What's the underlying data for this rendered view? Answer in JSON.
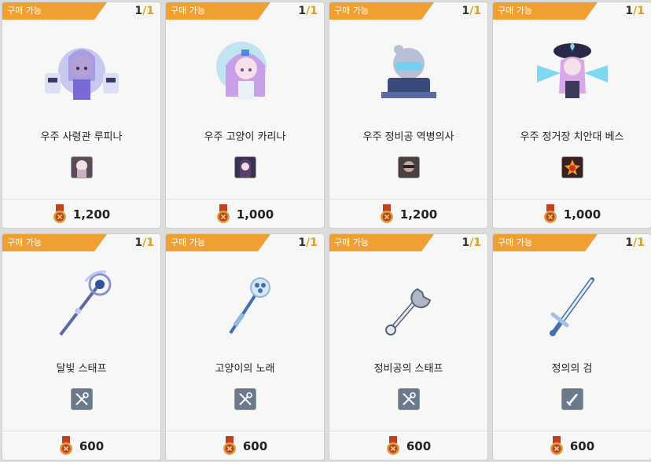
{
  "status_label": "구매 가능",
  "items": [
    {
      "name": "우주 사령관 루피나",
      "stock_current": "1",
      "stock_sep": "/",
      "stock_max": "1",
      "price": "1,200",
      "icon": "character-icon",
      "thumb_icon": "portrait-icon",
      "art_colors": [
        "#c8c8f0",
        "#7a6ad8",
        "#f4d4c0"
      ]
    },
    {
      "name": "우주 고양이 카리나",
      "stock_current": "1",
      "stock_sep": "/",
      "stock_max": "1",
      "price": "1,000",
      "icon": "character-icon",
      "thumb_icon": "portrait-icon",
      "art_colors": [
        "#a8dcf0",
        "#c8a0e8",
        "#f8e0e8"
      ]
    },
    {
      "name": "우주 정비공 역병의사",
      "stock_current": "1",
      "stock_sep": "/",
      "stock_max": "1",
      "price": "1,200",
      "icon": "character-icon",
      "thumb_icon": "portrait-icon",
      "art_colors": [
        "#b8c0d8",
        "#3a4a7a",
        "#70d0f0"
      ]
    },
    {
      "name": "우주 정거장 치안대 베스",
      "stock_current": "1",
      "stock_sep": "/",
      "stock_max": "1",
      "price": "1,000",
      "icon": "character-icon",
      "thumb_icon": "portrait-icon",
      "art_colors": [
        "#80d8f0",
        "#2a2a48",
        "#d8a8e8"
      ]
    },
    {
      "name": "달빛 스태프",
      "stock_current": "1",
      "stock_sep": "/",
      "stock_max": "1",
      "price": "600",
      "icon": "staff-icon",
      "thumb_icon": "weapon-icon",
      "art_colors": [
        "#8890d8",
        "#3050a0",
        "#c0c8f0"
      ]
    },
    {
      "name": "고양이의 노래",
      "stock_current": "1",
      "stock_sep": "/",
      "stock_max": "1",
      "price": "600",
      "icon": "staff-icon",
      "thumb_icon": "weapon-icon",
      "art_colors": [
        "#90b8e0",
        "#4070b0",
        "#d8e4f4"
      ]
    },
    {
      "name": "정비공의 스태프",
      "stock_current": "1",
      "stock_sep": "/",
      "stock_max": "1",
      "price": "600",
      "icon": "wrench-icon",
      "thumb_icon": "weapon-icon",
      "art_colors": [
        "#b0b8c8",
        "#5a6478",
        "#e4e8f0"
      ]
    },
    {
      "name": "정의의 검",
      "stock_current": "1",
      "stock_sep": "/",
      "stock_max": "1",
      "price": "600",
      "icon": "sword-icon",
      "thumb_icon": "sword-icon",
      "art_colors": [
        "#a0c0e8",
        "#4870a8",
        "#e0ecf8"
      ]
    }
  ],
  "colors": {
    "badge": "#f0a030",
    "stock_max": "#e0a020",
    "medal": "#c04020",
    "thumb_weapon_bg": "#6a7a8a"
  }
}
